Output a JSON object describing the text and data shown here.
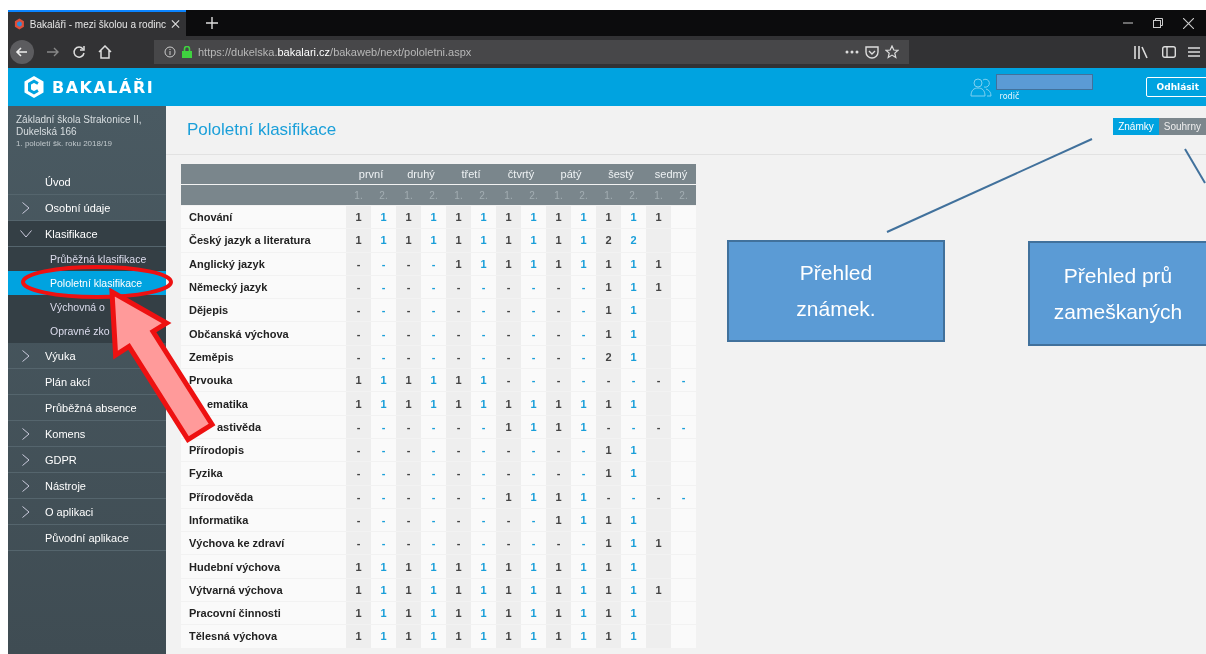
{
  "browser": {
    "tab_title": "Bakaláři - mezi školou a rodinc",
    "url": "https://dukelska.**bakalari.cz**/bakaweb/next/pololetni.aspx"
  },
  "header": {
    "logo": "BAKALÁŘI",
    "role": "rodič",
    "logout": "Odhlásit"
  },
  "sidebar": {
    "school": "Základní škola Strakonice II, Dukelská 166",
    "period": "1. pololetí šk. roku 2018/19",
    "items": [
      {
        "label": "Úvod",
        "selected": false
      },
      {
        "label": "Osobní údaje",
        "selected": false,
        "expanded": false
      },
      {
        "label": "Klasifikace",
        "selected": false,
        "expanded": true,
        "children": [
          {
            "label": "Průběžná klasifikace",
            "selected": false
          },
          {
            "label": "Pololetní klasifikace",
            "selected": true
          },
          {
            "label": "Výchovná o",
            "selected": false
          },
          {
            "label": "Opravné zko",
            "selected": false
          }
        ]
      },
      {
        "label": "Výuka",
        "selected": false,
        "expanded": false
      },
      {
        "label": "Plán akcí",
        "selected": false
      },
      {
        "label": "Průběžná absence",
        "selected": false
      },
      {
        "label": "Komens",
        "selected": false,
        "expanded": false
      },
      {
        "label": "GDPR",
        "selected": false,
        "expanded": false
      },
      {
        "label": "Nástroje",
        "selected": false,
        "expanded": false
      },
      {
        "label": "O aplikaci",
        "selected": false,
        "expanded": false
      },
      {
        "label": "Původní aplikace",
        "selected": false
      }
    ]
  },
  "page": {
    "title": "Pololetní klasifikace",
    "toggle": [
      {
        "label": "Známky",
        "selected": true
      },
      {
        "label": "Souhrny",
        "selected": false
      }
    ]
  },
  "table": {
    "grades": [
      {
        "name": "první",
        "terms": [
          "1.",
          "2."
        ]
      },
      {
        "name": "druhý",
        "terms": [
          "1.",
          "2."
        ]
      },
      {
        "name": "třetí",
        "terms": [
          "1.",
          "2."
        ]
      },
      {
        "name": "čtvrtý",
        "terms": [
          "1.",
          "2."
        ]
      },
      {
        "name": "pátý",
        "terms": [
          "1.",
          "2."
        ]
      },
      {
        "name": "šestý",
        "terms": [
          "1.",
          "2."
        ]
      },
      {
        "name": "sedmý",
        "terms": [
          "1.",
          "2."
        ]
      }
    ],
    "rows": [
      {
        "subject": "Chování",
        "marks": [
          "1",
          "1",
          "1",
          "1",
          "1",
          "1",
          "1",
          "1",
          "1",
          "1",
          "1",
          "1",
          "1"
        ]
      },
      {
        "subject": "Český jazyk a literatura",
        "marks": [
          "1",
          "1",
          "1",
          "1",
          "1",
          "1",
          "1",
          "1",
          "1",
          "1",
          "2",
          "2"
        ]
      },
      {
        "subject": "Anglický jazyk",
        "marks": [
          "-",
          "-",
          "-",
          "-",
          "1",
          "1",
          "1",
          "1",
          "1",
          "1",
          "1",
          "1",
          "1"
        ]
      },
      {
        "subject": "Německý jazyk",
        "marks": [
          "-",
          "-",
          "-",
          "-",
          "-",
          "-",
          "-",
          "-",
          "-",
          "-",
          "1",
          "1",
          "1"
        ]
      },
      {
        "subject": "Dějepis",
        "marks": [
          "-",
          "-",
          "-",
          "-",
          "-",
          "-",
          "-",
          "-",
          "-",
          "-",
          "1",
          "1"
        ]
      },
      {
        "subject": "Občanská výchova",
        "marks": [
          "-",
          "-",
          "-",
          "-",
          "-",
          "-",
          "-",
          "-",
          "-",
          "-",
          "1",
          "1"
        ]
      },
      {
        "subject": "Zeměpis",
        "marks": [
          "-",
          "-",
          "-",
          "-",
          "-",
          "-",
          "-",
          "-",
          "-",
          "-",
          "2",
          "1"
        ]
      },
      {
        "subject": "Prvouka",
        "marks": [
          "1",
          "1",
          "1",
          "1",
          "1",
          "1",
          "-",
          "-",
          "-",
          "-",
          "-",
          "-",
          "-",
          "-"
        ]
      },
      {
        "subject": "ematika",
        "marks": [
          "1",
          "1",
          "1",
          "1",
          "1",
          "1",
          "1",
          "1",
          "1",
          "1",
          "1",
          "1"
        ]
      },
      {
        "subject": "astivěda",
        "marks": [
          "-",
          "-",
          "-",
          "-",
          "-",
          "-",
          "1",
          "1",
          "1",
          "1",
          "-",
          "-",
          "-",
          "-"
        ]
      },
      {
        "subject": "Přírodopis",
        "marks": [
          "-",
          "-",
          "-",
          "-",
          "-",
          "-",
          "-",
          "-",
          "-",
          "-",
          "1",
          "1"
        ]
      },
      {
        "subject": "Fyzika",
        "marks": [
          "-",
          "-",
          "-",
          "-",
          "-",
          "-",
          "-",
          "-",
          "-",
          "-",
          "1",
          "1"
        ]
      },
      {
        "subject": "Přírodověda",
        "marks": [
          "-",
          "-",
          "-",
          "-",
          "-",
          "-",
          "1",
          "1",
          "1",
          "1",
          "-",
          "-",
          "-",
          "-"
        ]
      },
      {
        "subject": "Informatika",
        "marks": [
          "-",
          "-",
          "-",
          "-",
          "-",
          "-",
          "-",
          "-",
          "1",
          "1",
          "1",
          "1"
        ]
      },
      {
        "subject": "Výchova ke zdraví",
        "marks": [
          "-",
          "-",
          "-",
          "-",
          "-",
          "-",
          "-",
          "-",
          "-",
          "-",
          "1",
          "1",
          "1"
        ]
      },
      {
        "subject": "Hudební výchova",
        "marks": [
          "1",
          "1",
          "1",
          "1",
          "1",
          "1",
          "1",
          "1",
          "1",
          "1",
          "1",
          "1"
        ]
      },
      {
        "subject": "Výtvarná výchova",
        "marks": [
          "1",
          "1",
          "1",
          "1",
          "1",
          "1",
          "1",
          "1",
          "1",
          "1",
          "1",
          "1",
          "1"
        ]
      },
      {
        "subject": "Pracovní činnosti",
        "marks": [
          "1",
          "1",
          "1",
          "1",
          "1",
          "1",
          "1",
          "1",
          "1",
          "1",
          "1",
          "1"
        ]
      },
      {
        "subject": "Tělesná výchova",
        "marks": [
          "1",
          "1",
          "1",
          "1",
          "1",
          "1",
          "1",
          "1",
          "1",
          "1",
          "1",
          "1"
        ]
      }
    ]
  },
  "callouts": [
    {
      "text": "Přehled známek."
    },
    {
      "text": "Přehled prů zameškaných"
    }
  ]
}
